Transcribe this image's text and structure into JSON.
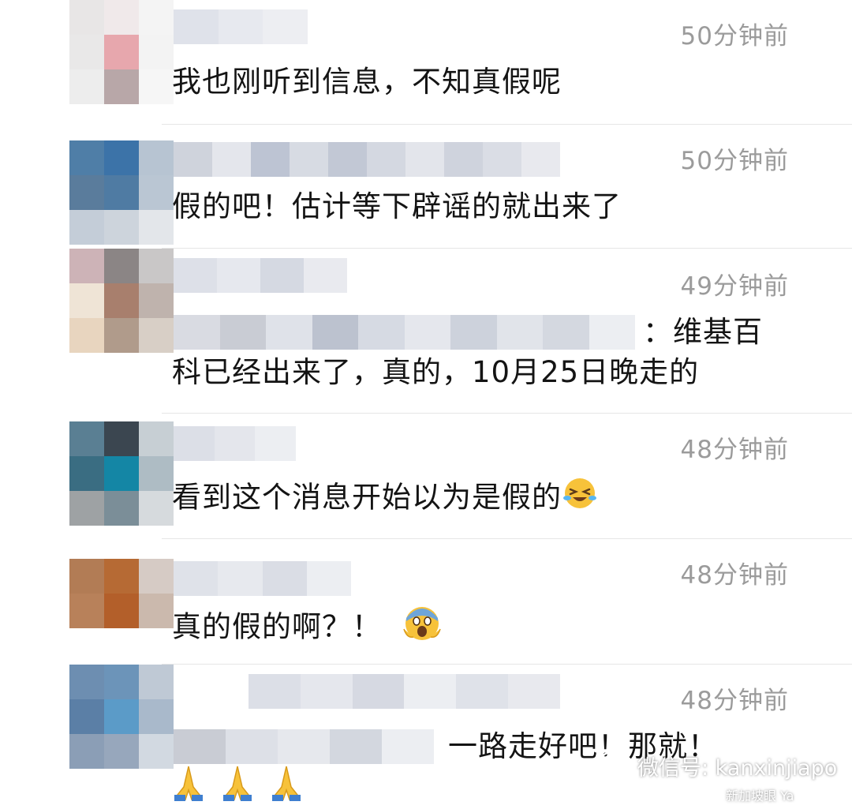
{
  "comments": [
    {
      "time": "50分钟前",
      "text": "我也刚听到信息，不知真假呢"
    },
    {
      "time": "50分钟前",
      "text": "假的吧！估计等下辟谣的就出来了"
    },
    {
      "time": "49分钟前",
      "text_line1": "：维基百",
      "text_line2": "科已经出来了，真的，10月25日晚走的"
    },
    {
      "time": "48分钟前",
      "text": "看到这个消息开始以为是假的",
      "emoji": "crying-laughing-face-icon"
    },
    {
      "time": "48分钟前",
      "text": "真的假的啊？！",
      "emoji": "screaming-face-icon"
    },
    {
      "time": "48分钟前",
      "text": "一路走好吧！那就！",
      "emoji": "folded-hands-icon"
    }
  ],
  "watermark": {
    "label": "微信号: kanxinjiapo",
    "sub": "新加坡眼 Ya"
  },
  "colors": {
    "time_gray": "#9b9b9b",
    "divider": "#e6e6e6"
  }
}
